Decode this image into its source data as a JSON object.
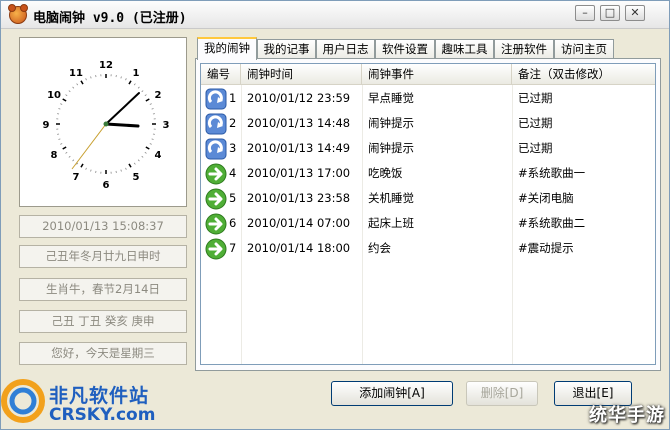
{
  "window": {
    "title": "电脑闹钟 v9.0 (已注册)",
    "min_label": "–",
    "max_label": "□",
    "close_label": "✕"
  },
  "clock": {
    "numbers": [
      "12",
      "1",
      "2",
      "3",
      "4",
      "5",
      "6",
      "7",
      "8",
      "9",
      "10",
      "11"
    ]
  },
  "info": {
    "datetime": "2010/01/13 15:08:37",
    "lunar": "己丑年冬月廿九日申时",
    "zodiac": "生肖牛，春节2月14日",
    "ganzhi": "己丑 丁丑 癸亥 庚申",
    "greeting": "您好，今天是星期三"
  },
  "tabs": [
    "我的闹钟",
    "我的记事",
    "用户日志",
    "软件设置",
    "趣味工具",
    "注册软件",
    "访问主页"
  ],
  "table": {
    "headers": [
      "编号",
      "闹钟时间",
      "闹钟事件",
      "备注（双击修改）"
    ],
    "rows": [
      {
        "no": "1",
        "time": "2010/01/12 23:59",
        "event": "早点睡觉",
        "note": "已过期",
        "icon": "expired-arrow-icon"
      },
      {
        "no": "2",
        "time": "2010/01/13 14:48",
        "event": "闹钟提示",
        "note": "已过期",
        "icon": "expired-arrow-icon"
      },
      {
        "no": "3",
        "time": "2010/01/13 14:49",
        "event": "闹钟提示",
        "note": "已过期",
        "icon": "expired-arrow-icon"
      },
      {
        "no": "4",
        "time": "2010/01/13 17:00",
        "event": "吃晚饭",
        "note": "#系统歌曲一",
        "icon": "active-arrow-icon"
      },
      {
        "no": "5",
        "time": "2010/01/13 23:58",
        "event": "关机睡觉",
        "note": "#关闭电脑",
        "icon": "active-arrow-icon"
      },
      {
        "no": "6",
        "time": "2010/01/14 07:00",
        "event": "起床上班",
        "note": "#系统歌曲二",
        "icon": "active-arrow-icon"
      },
      {
        "no": "7",
        "time": "2010/01/14 18:00",
        "event": "约会",
        "note": "#震动提示",
        "icon": "active-arrow-icon"
      }
    ]
  },
  "buttons": {
    "add": "添加闹钟[A]",
    "delete": "删除[D]",
    "exit": "退出[E]"
  },
  "watermark": {
    "site_cn": "非凡软件站",
    "site_en": "CRSKY.com",
    "right": "统华手游"
  }
}
